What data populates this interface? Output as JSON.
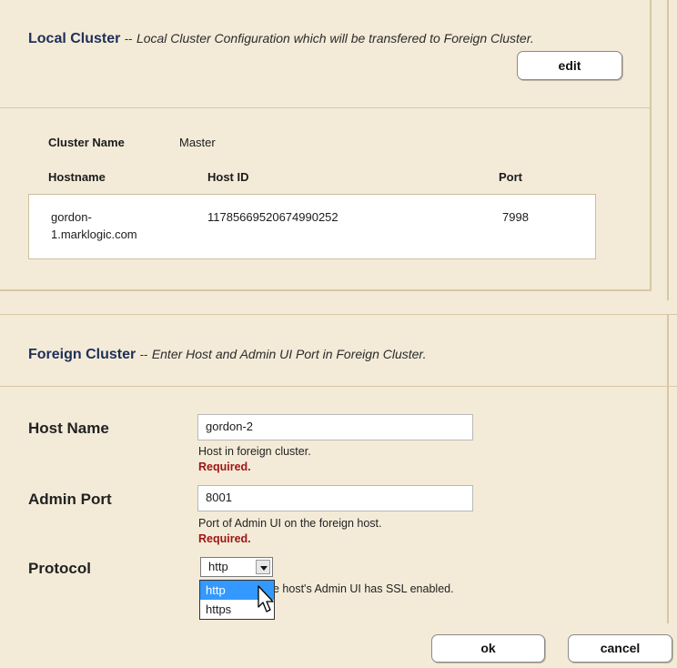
{
  "local": {
    "title": "Local Cluster",
    "sep": "--",
    "subtitle": "Local Cluster Configuration which will be transfered to Foreign Cluster.",
    "edit_label": "edit",
    "cluster_name_label": "Cluster Name",
    "cluster_name_value": "Master",
    "columns": [
      "Hostname",
      "Host ID",
      "Port"
    ],
    "row": {
      "hostname_line1": "gordon-",
      "hostname_line2": "1.marklogic.com",
      "host_id": "11785669520674990252",
      "port": "7998"
    }
  },
  "foreign": {
    "title": "Foreign Cluster",
    "sep": "--",
    "subtitle": "Enter Host and Admin UI Port in Foreign Cluster.",
    "host_name_label": "Host Name",
    "host_name_value": "gordon-2",
    "host_name_help": "Host in foreign cluster.",
    "host_name_required": "Required.",
    "admin_port_label": "Admin Port",
    "admin_port_value": "8001",
    "admin_port_help": "Port of Admin UI on the foreign host.",
    "admin_port_required": "Required.",
    "protocol_label": "Protocol",
    "protocol_value": "http",
    "protocol_help_visible": "e host's Admin UI has SSL enabled.",
    "protocol_options": [
      "http",
      "https"
    ]
  },
  "actions": {
    "ok_label": "ok",
    "cancel_label": "cancel"
  },
  "colors": {
    "background": "#f3ebd8",
    "title": "#1f2f57",
    "required": "#a01515",
    "selected_option": "#3399ff"
  }
}
